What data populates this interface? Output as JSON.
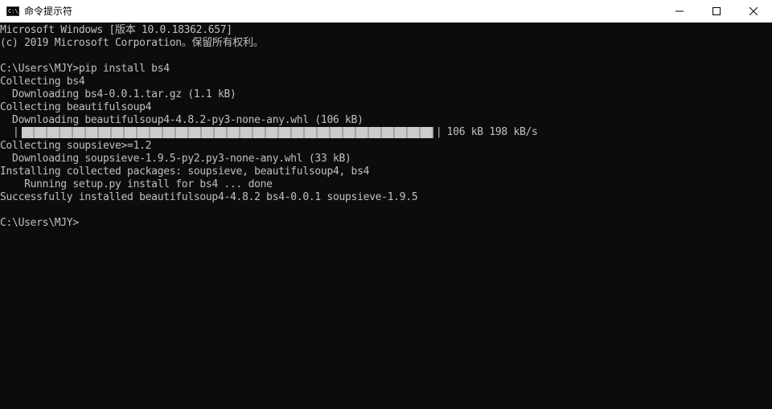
{
  "window": {
    "title": "命令提示符",
    "app_icon_glyph": "C:\\",
    "icons": {
      "app": "command-prompt-icon",
      "minimize": "minimize-icon",
      "maximize": "maximize-icon",
      "close": "close-icon"
    }
  },
  "console": {
    "text_color": "#c0c0c0",
    "background_color": "#0c0c0c",
    "lines": [
      "Microsoft Windows [版本 10.0.18362.657]",
      "(c) 2019 Microsoft Corporation。保留所有权利。",
      "",
      "C:\\Users\\MJY>pip install bs4",
      "Collecting bs4",
      "  Downloading bs4-0.0.1.tar.gz (1.1 kB)",
      "Collecting beautifulsoup4",
      "  Downloading beautifulsoup4-4.8.2-py3-none-any.whl (106 kB)"
    ],
    "progress": {
      "fraction": 1.0,
      "left_edge": "|",
      "right_edge": "|",
      "stats": "106 kB 198 kB/s"
    },
    "lines_after": [
      "Collecting soupsieve>=1.2",
      "  Downloading soupsieve-1.9.5-py2.py3-none-any.whl (33 kB)",
      "Installing collected packages: soupsieve, beautifulsoup4, bs4",
      "    Running setup.py install for bs4 ... done",
      "Successfully installed beautifulsoup4-4.8.2 bs4-0.0.1 soupsieve-1.9.5",
      "",
      "C:\\Users\\MJY>"
    ]
  }
}
